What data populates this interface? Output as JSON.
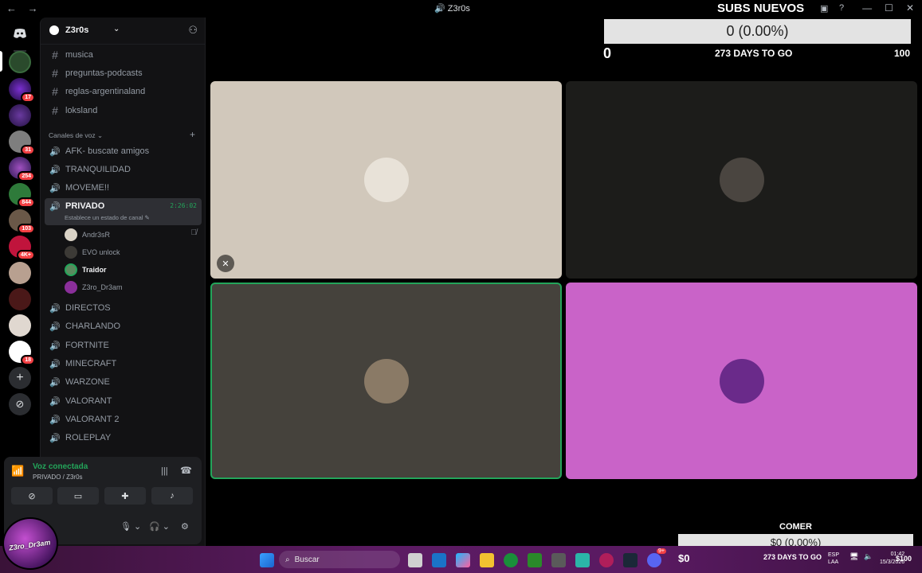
{
  "window": {
    "title": "Z3r0s",
    "back_glyph": "←",
    "forward_glyph": "→",
    "controls": [
      "—",
      "☐",
      "✕"
    ]
  },
  "server_rail": {
    "badges": [
      "17",
      "31",
      "254",
      "844",
      "103",
      "4K+",
      "18"
    ]
  },
  "guild": {
    "name": "Z3r0s"
  },
  "text_channels": [
    {
      "label": "musica"
    },
    {
      "label": "preguntas-podcasts"
    },
    {
      "label": "reglas-argentinaland"
    },
    {
      "label": "loksland"
    }
  ],
  "voice_category": "Canales de voz",
  "voice_channels_top": [
    {
      "label": "AFK- buscate amigos"
    },
    {
      "label": "TRANQUILIDAD"
    },
    {
      "label": "MOVEME!!"
    }
  ],
  "active_channel": {
    "label": "PRIVADO",
    "timer": "2:26:02",
    "status": "Establece un estado de canal"
  },
  "voice_users": [
    {
      "name": "Andr3sR",
      "avatar_color": "#d9d2c6",
      "bold": false
    },
    {
      "name": "EVO unlock",
      "avatar_color": "#3c3a36",
      "bold": false
    },
    {
      "name": "Traidor",
      "avatar_color": "#5b8a5f",
      "bold": true
    },
    {
      "name": "Z3ro_Dr3am",
      "avatar_color": "#8a2f9a",
      "bold": false
    }
  ],
  "voice_channels_bottom": [
    {
      "label": "DIRECTOS"
    },
    {
      "label": "CHARLANDO"
    },
    {
      "label": "FORTNITE"
    },
    {
      "label": "MINECRAFT"
    },
    {
      "label": "WARZONE"
    },
    {
      "label": "VALORANT"
    },
    {
      "label": "VALORANT 2"
    },
    {
      "label": "ROLEPLAY"
    }
  ],
  "voice_panel": {
    "status": "Voz conectada",
    "location": "PRIVADO / Z3r0s"
  },
  "subs_goal": {
    "title": "SUBS NUEVOS",
    "progress_text": "0 (0.00%)",
    "progress": 0.0,
    "min": "0",
    "days": "273 DAYS TO GO",
    "max": "100"
  },
  "tiles": [
    {
      "bg": "#d1c8bb",
      "avatar": "#e8e2d8",
      "muted": true,
      "speaking": false
    },
    {
      "bg": "#1c1c1a",
      "avatar": "#4a4540",
      "muted": false,
      "speaking": false
    },
    {
      "bg": "#45423c",
      "avatar": "#8a7a66",
      "muted": false,
      "speaking": true
    },
    {
      "bg": "#c963c8",
      "avatar": "#6a2a8a",
      "muted": false,
      "speaking": false
    }
  ],
  "comer_goal": {
    "title": "COMER",
    "progress_text": "$0 (0.00%)",
    "progress": 0.0,
    "min": "$0",
    "days": "273 DAYS TO GO",
    "max": "$100"
  },
  "taskbar": {
    "search_placeholder": "Buscar",
    "lang1": "ESP",
    "lang2": "LAA",
    "time": "01:42",
    "date": "15/3/2026",
    "discord_badge": "9+"
  },
  "corner_logo_text": "Z3ro_Dr3am"
}
